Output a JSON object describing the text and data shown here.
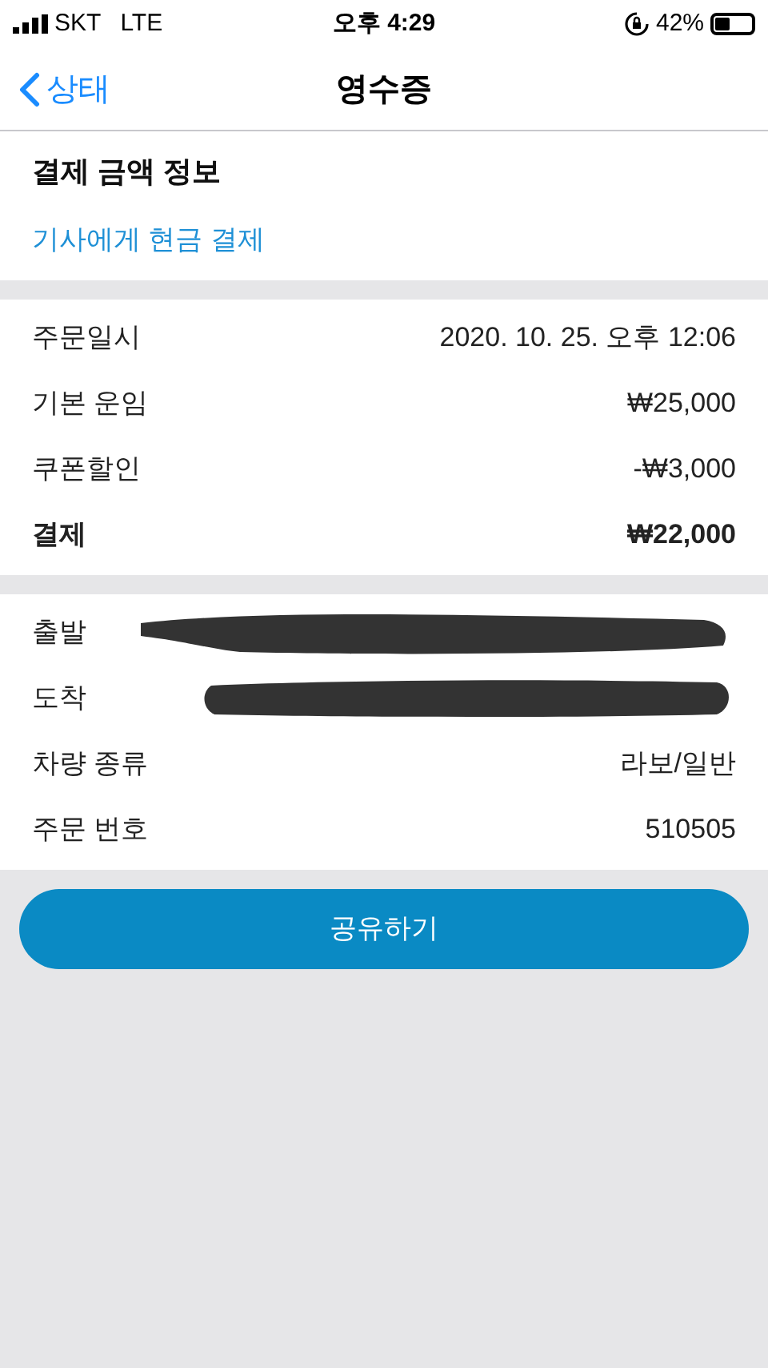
{
  "status_bar": {
    "carrier": "SKT",
    "network": "LTE",
    "time": "오후 4:29",
    "battery_text": "42%"
  },
  "nav": {
    "back": "상태",
    "title": "영수증"
  },
  "payment_info": {
    "title": "결제 금액 정보",
    "method": "기사에게 현금 결제"
  },
  "charges": [
    {
      "label": "주문일시",
      "value": "2020. 10. 25. 오후 12:06",
      "bold": false
    },
    {
      "label": "기본 운임",
      "value": "₩25,000",
      "bold": false
    },
    {
      "label": "쿠폰할인",
      "value": "-₩3,000",
      "bold": false
    },
    {
      "label": "결제",
      "value": "₩22,000",
      "bold": true
    }
  ],
  "details": [
    {
      "label": "출발",
      "kind": "redacted"
    },
    {
      "label": "도착",
      "kind": "redacted"
    },
    {
      "label": "차량 종류",
      "kind": "text",
      "value": "라보/일반"
    },
    {
      "label": "주문 번호",
      "kind": "text",
      "value": "510505"
    }
  ],
  "share_button": "공유하기"
}
